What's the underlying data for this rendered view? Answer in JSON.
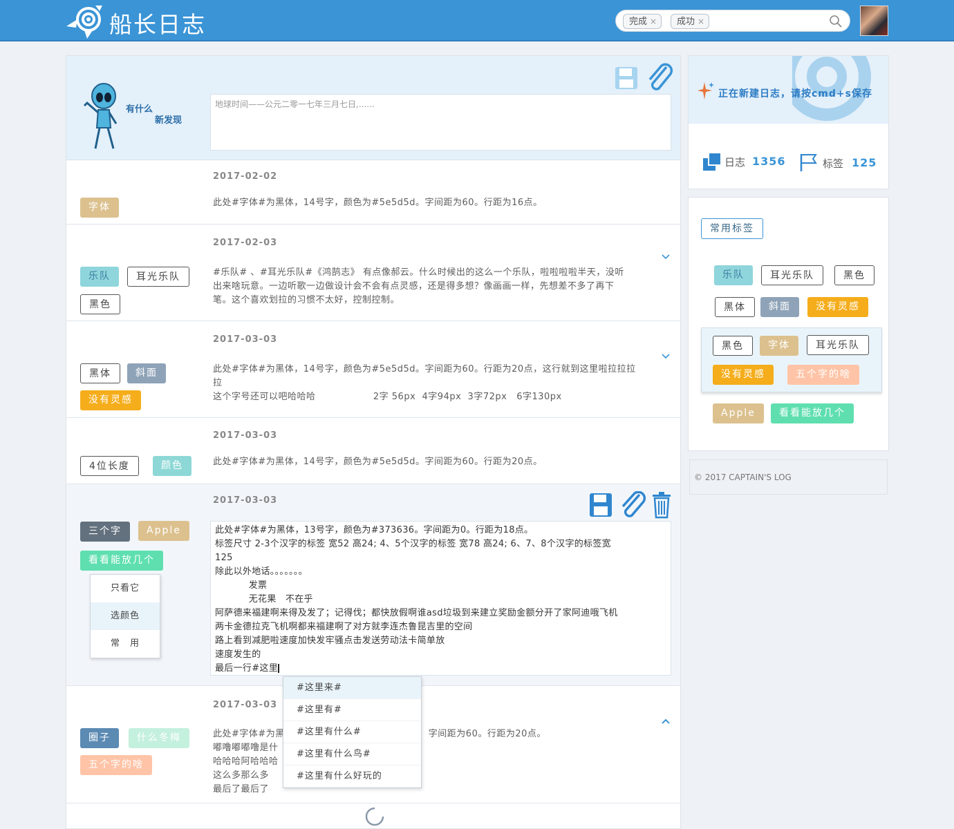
{
  "app": {
    "title": "船长日志"
  },
  "search": {
    "chips": [
      "完成",
      "成功"
    ],
    "chip_close": "×",
    "placeholder": ""
  },
  "composer": {
    "caption_line1": "有什么",
    "caption_line2": "新发现",
    "placeholder": "地球时间——公元二零一七年三月七日,......"
  },
  "entries": [
    {
      "date": "2017-02-02",
      "tags": [
        "字体"
      ],
      "lines": [
        "此处#字体#为黑体，14号字，颜色为#5e5d5d。字间距为60。行距为16点。"
      ]
    },
    {
      "date": "2017-02-03",
      "tags": [
        "乐队",
        "耳光乐队",
        "黑色"
      ],
      "lines": [
        "#乐队# 、#耳光乐队#《鸿鹄志》 有点像郝云。什么时候出的这么一个乐队，啦啦啦啦半天，没听",
        "出来啥玩意。一边听歌一边做设计会不会有点灵感，还是得多想？像画画一样，先想差不多了再下",
        "笔。这个喜欢划拉的习惯不太好，控制控制。"
      ]
    },
    {
      "date": "2017-03-03",
      "tags": [
        "黑体",
        "斜面",
        "没有灵感"
      ],
      "lines": [
        "此处#字体#为黑体，14号字，颜色为#5e5d5d。字间距为60。行距为20点，这行就到这里啦拉拉拉",
        "拉",
        "这个字号还可以吧哈哈哈                  2字 56px  4字94px  3字72px   6字130px"
      ]
    },
    {
      "date": "2017-03-03",
      "tags": [
        "4位长度",
        "颜色"
      ],
      "lines": [
        "此处#字体#为黑体，14号字，颜色为#5e5d5d。字间距为60。行距为20点。"
      ]
    },
    {
      "date": "2017-03-03",
      "tags": [
        "三个字",
        "Apple",
        "看看能放几个"
      ],
      "menu": [
        "只看它",
        "选颜色",
        "常　用"
      ],
      "edit_lines": [
        "此处#字体#为黑体，13号字，颜色为#373636。字间距为0。行距为18点。",
        "标签尺寸 2-3个汉字的标签 宽52 高24; 4、5个汉字的标签 宽78 高24; 6、7、8个汉字的标签宽",
        "125",
        "除此以外地话。。。。。。。",
        "           发票",
        "           无花果   不在乎",
        "阿萨德来福建啊来得及发了；记得伐；都快放假啊谁asd垃圾到来建立奖励金额分开了家阿迪哦飞机",
        "两卡金德拉克飞机啊都来福建啊了对方就李连杰鲁昆吉里的空间",
        "路上看到减肥啦速度加快发牢骚点击发送劳动法卡简单放",
        "速度发生的",
        "最后一行#这里"
      ]
    },
    {
      "date": "2017-03-03",
      "tags": [
        "圈子",
        "什么冬梅",
        "五个字的啥"
      ],
      "lines": [
        "此处#字体#为黑体，14号字，颜色为#5e5d5d。字间距为60。行距为20点。",
        "嘟噜嘟嘟噜是什",
        "哈哈哈阿哈哈哈",
        "这么多那么多",
        "最后了最后了"
      ],
      "line1_left": "此处#字体#为黑",
      "line1_right": "字间距为60。行距为20点。"
    }
  ],
  "autocomplete": [
    "#这里来#",
    "#这里有#",
    "#这里有什么#",
    "#这里有什么鸟#",
    "#这里有什么好玩的"
  ],
  "sidebar": {
    "notice": "正在新建日志，请按cmd+s保存",
    "stats": [
      {
        "label": "日志",
        "value": "1356"
      },
      {
        "label": "标签",
        "value": "125"
      }
    ],
    "common_tags_title": "常用标签",
    "tags_row1": [
      "乐队",
      "耳光乐队",
      "黑色"
    ],
    "tags_row2": [
      "黑体",
      "斜面",
      "没有灵感"
    ],
    "inner_row1": [
      "黑色",
      "字体",
      "耳光乐队"
    ],
    "inner_row2": [
      "没有灵感",
      "五个字的啥"
    ],
    "tags_row3": [
      "Apple",
      "看看能放几个"
    ]
  },
  "footer": {
    "text": "© 2017 CAPTAIN'S LOG"
  },
  "colors": {
    "brand": "#3a94d6",
    "text": "#5e5d5d"
  }
}
